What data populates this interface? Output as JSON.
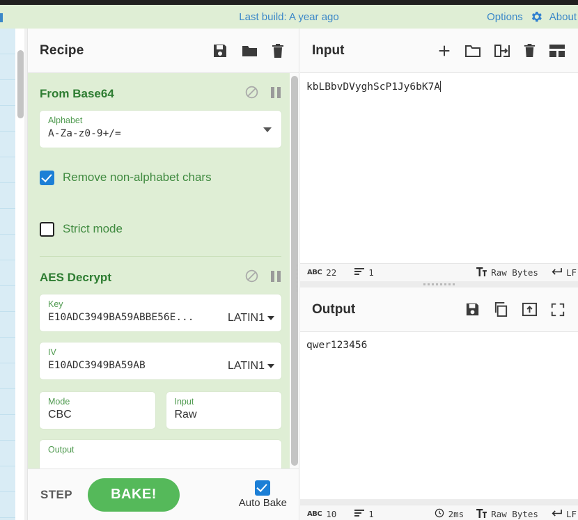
{
  "banner": {
    "build_text": "Last build: A year ago",
    "options_label": "Options",
    "about_label": "About",
    "gear_icon": "gear-icon",
    "link_color": "#3a87c8",
    "background": "#dfeed5"
  },
  "recipe": {
    "title": "Recipe",
    "icons": [
      "save-icon",
      "folder-icon",
      "trash-icon"
    ],
    "operations": [
      {
        "name": "From Base64",
        "disable_icon": "disable-icon",
        "pause_icon": "pause-icon",
        "args": [
          {
            "type": "select",
            "label": "Alphabet",
            "value": "A-Za-z0-9+/="
          },
          {
            "type": "checkbox",
            "label": "Remove non-alphabet chars",
            "checked": true
          },
          {
            "type": "checkbox",
            "label": "Strict mode",
            "checked": false
          }
        ]
      },
      {
        "name": "AES Decrypt",
        "disable_icon": "disable-icon",
        "pause_icon": "pause-icon",
        "args": [
          {
            "type": "toggle-text",
            "label": "Key",
            "value": "E10ADC3949BA59ABBE56E...",
            "encoding": "LATIN1"
          },
          {
            "type": "toggle-text",
            "label": "IV",
            "value": "E10ADC3949BA59AB",
            "encoding": "LATIN1"
          },
          {
            "type": "select",
            "label": "Mode",
            "value": "CBC"
          },
          {
            "type": "select",
            "label": "Input",
            "value": "Raw"
          },
          {
            "type": "select",
            "label": "Output",
            "value": ""
          }
        ]
      }
    ],
    "controls": {
      "step_label": "STEP",
      "bake_label": "BAKE!",
      "bake_color": "#55b95a",
      "auto_bake_label": "Auto Bake",
      "auto_bake_checked": true
    }
  },
  "input": {
    "title": "Input",
    "icons": [
      "add-tab-icon",
      "folder-icon",
      "import-folder-icon",
      "trash-icon",
      "tabs-layout-icon"
    ],
    "value": "kbLBbvDVyghScP1Jy6bK7A",
    "status": {
      "length_icon": "abc-icon",
      "length": "22",
      "lines_icon": "lines-icon",
      "lines": "1",
      "encoding_icon": "font-icon",
      "encoding": "Raw Bytes",
      "eol_icon": "enter-icon",
      "eol": "LF"
    }
  },
  "output": {
    "title": "Output",
    "icons": [
      "save-icon",
      "copy-icon",
      "open-in-tab-icon",
      "fullscreen-icon"
    ],
    "value": "qwer123456",
    "status": {
      "length_icon": "abc-icon",
      "length": "10",
      "lines_icon": "lines-icon",
      "lines": "1",
      "time_icon": "clock-icon",
      "time": "2ms",
      "encoding_icon": "font-icon",
      "encoding": "Raw Bytes",
      "eol_icon": "enter-icon",
      "eol": "LF"
    }
  },
  "operations_list": {
    "item_count": 19,
    "background": "#d7ebf4"
  }
}
